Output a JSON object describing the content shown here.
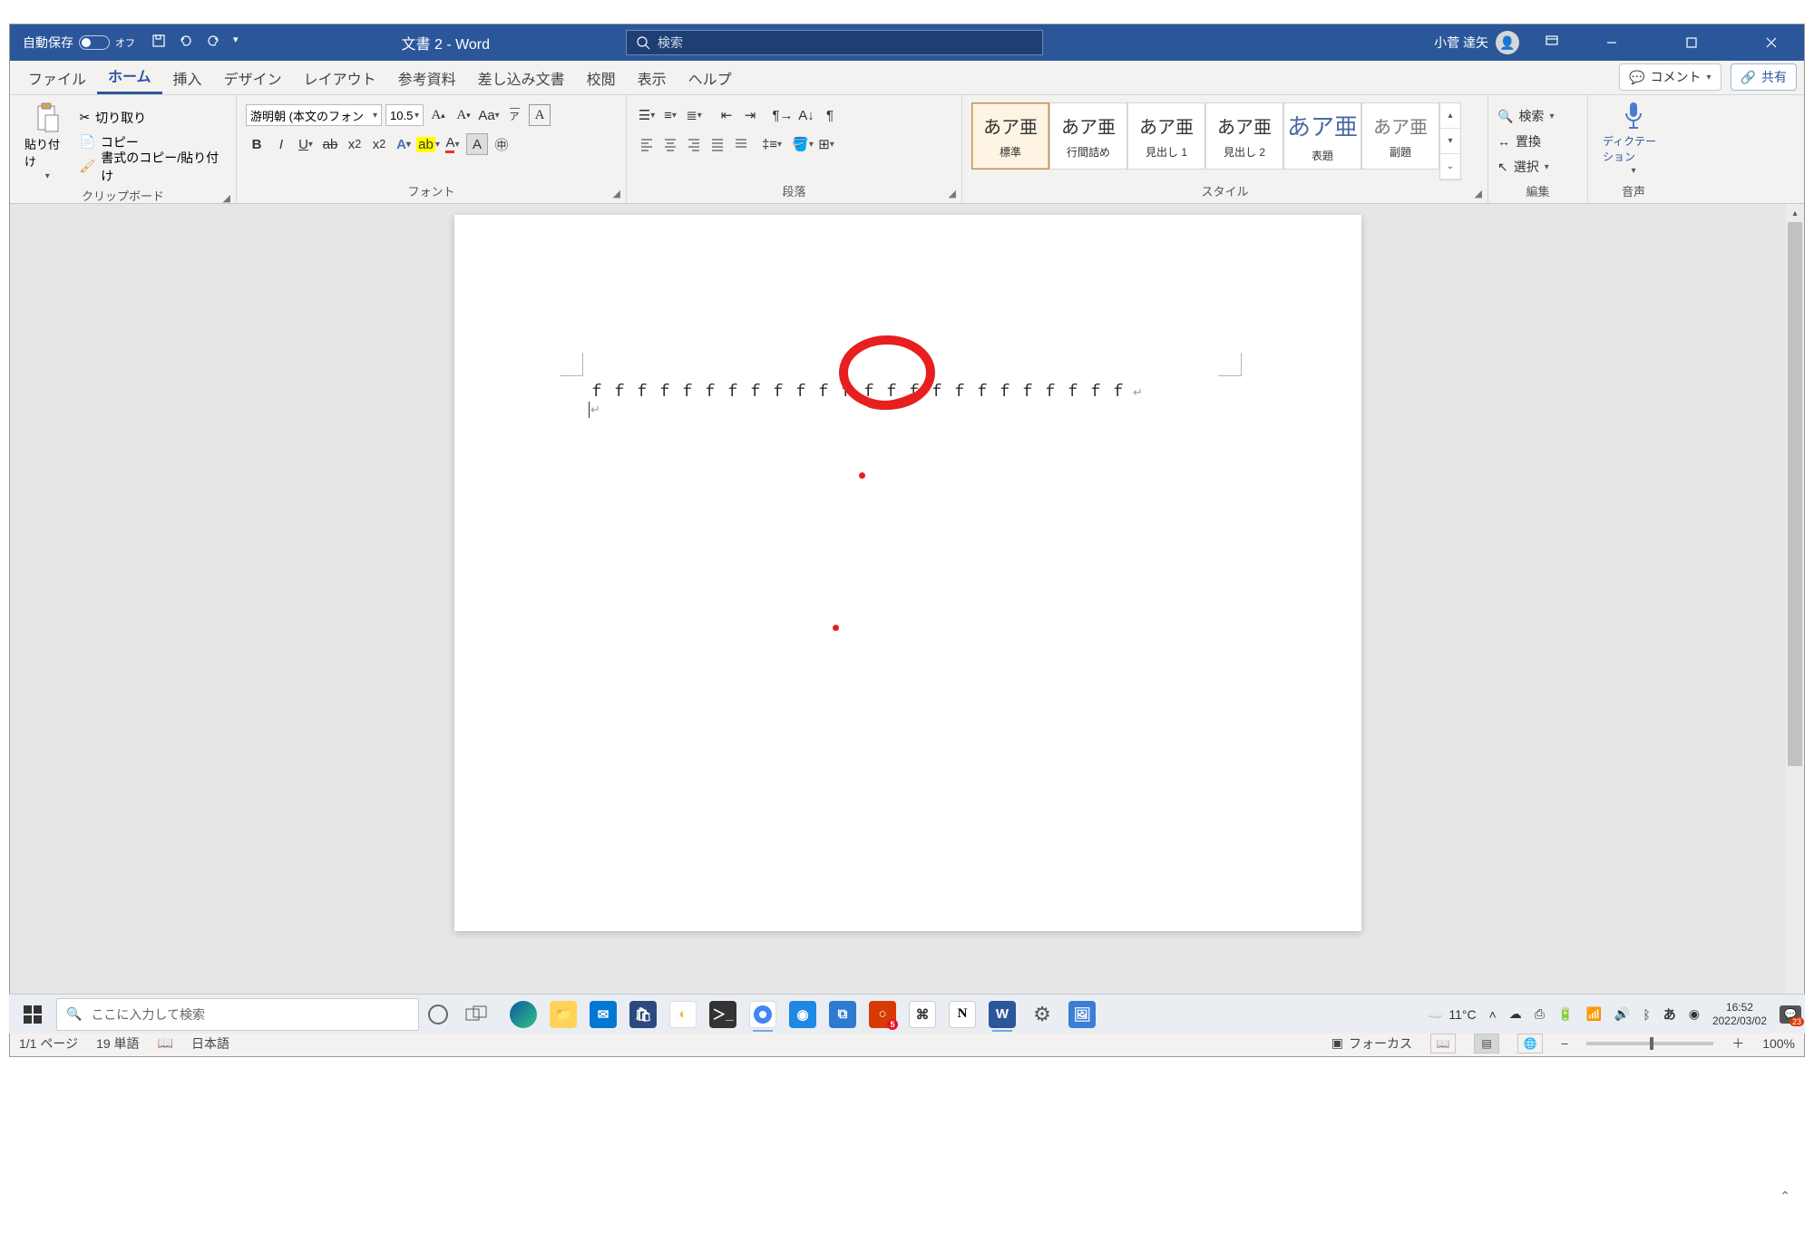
{
  "titlebar": {
    "autosave_label": "自動保存",
    "autosave_state": "オフ",
    "doc_title": "文書 2  -  Word",
    "search_placeholder": "検索",
    "user_name": "小菅 達矢"
  },
  "tabs": {
    "file": "ファイル",
    "home": "ホーム",
    "insert": "挿入",
    "design": "デザイン",
    "layout": "レイアウト",
    "references": "参考資料",
    "mailings": "差し込み文書",
    "review": "校閲",
    "view": "表示",
    "help": "ヘルプ",
    "comments": "コメント",
    "share": "共有"
  },
  "ribbon": {
    "clipboard": {
      "paste": "貼り付け",
      "cut": "切り取り",
      "copy": "コピー",
      "format_painter": "書式のコピー/貼り付け",
      "label": "クリップボード"
    },
    "font": {
      "name": "游明朝 (本文のフォン",
      "size": "10.5",
      "label": "フォント"
    },
    "paragraph": {
      "label": "段落"
    },
    "styles": {
      "sample": "あア亜",
      "items": [
        "標準",
        "行間詰め",
        "見出し 1",
        "見出し 2",
        "表題",
        "副題"
      ],
      "label": "スタイル"
    },
    "editing": {
      "find": "検索",
      "replace": "置換",
      "select": "選択",
      "label": "編集"
    },
    "voice": {
      "dictate": "ディクテーション",
      "label": "音声"
    }
  },
  "document": {
    "line1": "ｆｆｆｆｆｆｆｆｆｆｆｆｆｆｆｆｆｆｆｆｆｆｆｆ"
  },
  "statusbar": {
    "page": "1/1 ページ",
    "words": "19 単語",
    "lang": "日本語",
    "focus": "フォーカス",
    "zoom": "100%"
  },
  "taskbar": {
    "search_placeholder": "ここに入力して検索",
    "weather": "11°C",
    "time": "16:52",
    "date": "2022/03/02",
    "notif_count": "23"
  }
}
